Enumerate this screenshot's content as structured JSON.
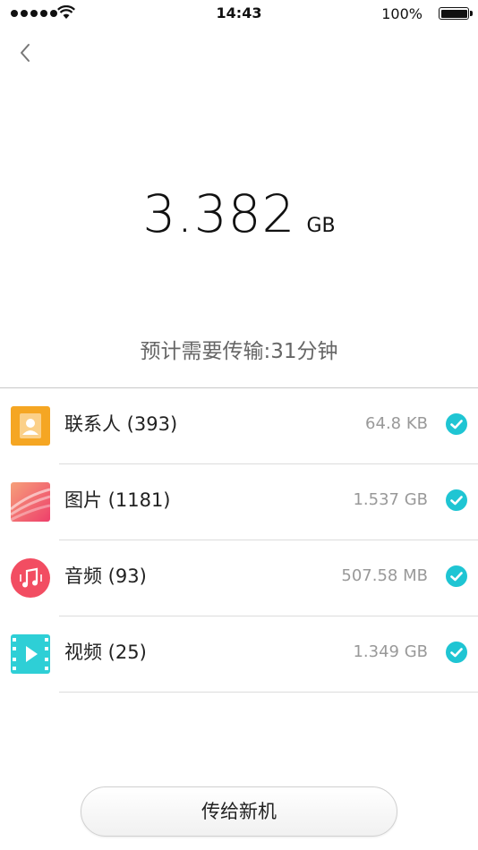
{
  "status_bar": {
    "time": "14:43",
    "battery_percent": "100%",
    "signal_bars": 5,
    "icons": [
      "signal-dots-icon",
      "wifi-icon",
      "battery-icon"
    ]
  },
  "header": {
    "back_icon": "chevron-left-icon"
  },
  "summary": {
    "total_value": "3.382",
    "total_unit": "GB",
    "estimate_text": "预计需要传输:31分钟"
  },
  "items": [
    {
      "label": "联系人 (393)",
      "size": "64.8 KB",
      "icon": "contacts-icon",
      "checked": true
    },
    {
      "label": "图片 (1181)",
      "size": "1.537 GB",
      "icon": "photos-icon",
      "checked": true
    },
    {
      "label": "音频 (93)",
      "size": "507.58 MB",
      "icon": "music-icon",
      "checked": true
    },
    {
      "label": "视频 (25)",
      "size": "1.349 GB",
      "icon": "video-icon",
      "checked": true
    }
  ],
  "colors": {
    "accent_check": "#1fc5d3",
    "contacts": "#f5a623",
    "photos": "#f0506e",
    "music": "#f24d62",
    "video": "#2ecfd6"
  },
  "footer": {
    "send_button_label": "传给新机"
  }
}
